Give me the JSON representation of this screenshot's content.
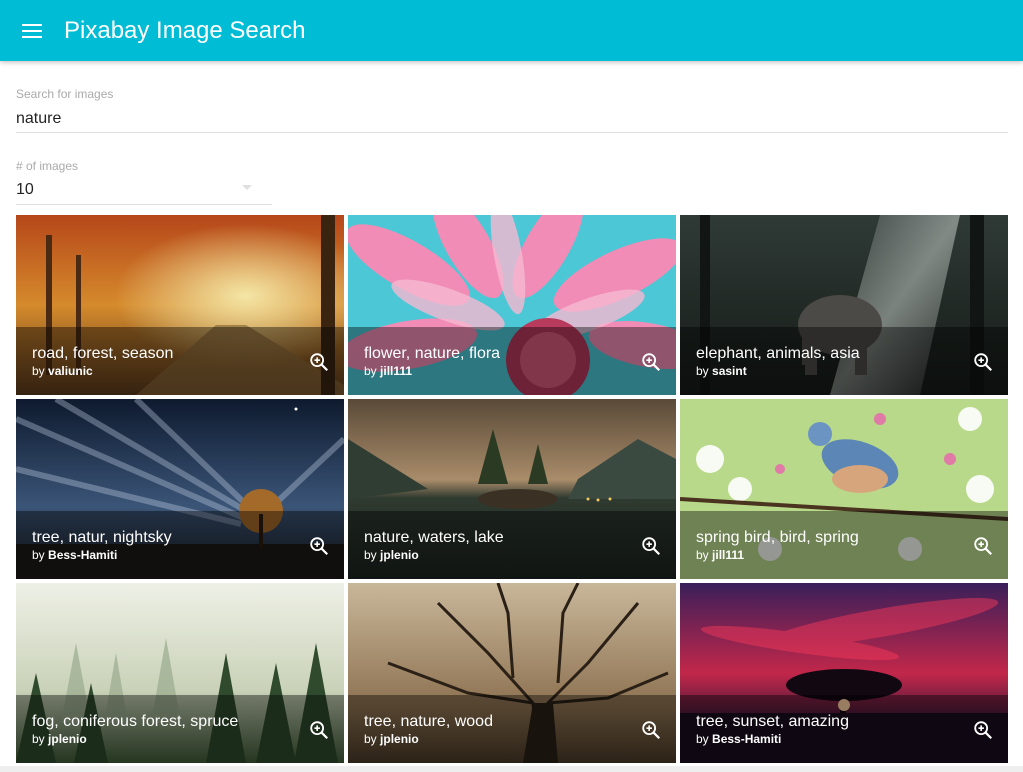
{
  "appbar": {
    "title": "Pixabay Image Search",
    "menu_icon": "menu-icon",
    "color": "#00bcd4"
  },
  "search": {
    "label": "Search for images",
    "value": "nature"
  },
  "count": {
    "label": "# of images",
    "value": "10"
  },
  "tiles": [
    {
      "title": "road, forest, season",
      "by": "by",
      "author": "valiunic"
    },
    {
      "title": "flower, nature, flora",
      "by": "by",
      "author": "jill111"
    },
    {
      "title": "elephant, animals, asia",
      "by": "by",
      "author": "sasint"
    },
    {
      "title": "tree, natur, nightsky",
      "by": "by",
      "author": "Bess-Hamiti"
    },
    {
      "title": "nature, waters, lake",
      "by": "by",
      "author": "jplenio"
    },
    {
      "title": "spring bird, bird, spring",
      "by": "by",
      "author": "jill111"
    },
    {
      "title": "fog, coniferous forest, spruce",
      "by": "by",
      "author": "jplenio"
    },
    {
      "title": "tree, nature, wood",
      "by": "by",
      "author": "jplenio"
    },
    {
      "title": "tree, sunset, amazing",
      "by": "by",
      "author": "Bess-Hamiti"
    }
  ],
  "icons": {
    "zoom": "zoom-in-icon"
  }
}
